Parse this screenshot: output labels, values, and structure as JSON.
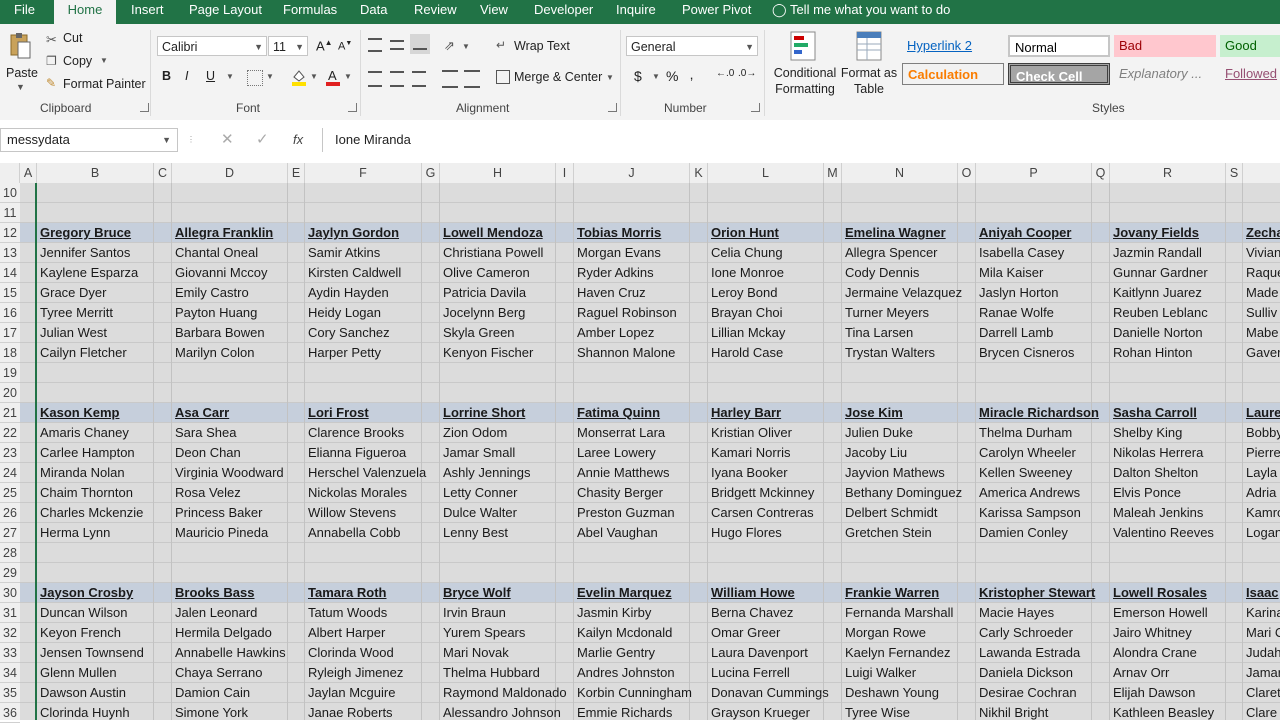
{
  "ribbon_tabs": [
    "File",
    "Home",
    "Insert",
    "Page Layout",
    "Formulas",
    "Data",
    "Review",
    "View",
    "Developer",
    "Inquire",
    "Power Pivot"
  ],
  "tell_me": "Tell me what you want to do",
  "clipboard": {
    "paste": "Paste",
    "cut": "Cut",
    "copy": "Copy",
    "format_painter": "Format Painter",
    "label": "Clipboard"
  },
  "font": {
    "name": "Calibri",
    "size": "11",
    "bold": "B",
    "italic": "I",
    "underline": "U",
    "label": "Font",
    "font_color": "#e02020",
    "fill_color": "#ffe000"
  },
  "alignment": {
    "wrap_text": "Wrap Text",
    "merge_center": "Merge & Center",
    "label": "Alignment"
  },
  "number": {
    "format": "General",
    "currency": "$",
    "percent": "%",
    "comma": "‚",
    "label": "Number"
  },
  "styles": {
    "conditional_formatting": "Conditional Formatting",
    "format_as_table": "Format as Table",
    "label": "Styles",
    "cells": [
      {
        "text": "Hyperlink 2",
        "color": "#0563c1",
        "bg": "#f3f3f3"
      },
      {
        "text": "Normal",
        "color": "#000000",
        "bg": "#ffffff"
      },
      {
        "text": "Bad",
        "color": "#9c0006",
        "bg": "#ffc7ce"
      },
      {
        "text": "Good",
        "color": "#006100",
        "bg": "#c6efce"
      },
      {
        "text": "Calculation",
        "color": "#fa7d00",
        "bg": "#f2f2f2"
      },
      {
        "text": "Check Cell",
        "color": "#ffffff",
        "bg": "#a5a5a5"
      },
      {
        "text": "Explanatory ...",
        "color": "#7f7f7f",
        "bg": "#f3f3f3"
      },
      {
        "text": "Followed",
        "color": "#954f72",
        "bg": "#f3f3f3"
      }
    ]
  },
  "name_box": "messydata",
  "formula": "Ione Miranda",
  "fx": "fx",
  "columns": [
    "A",
    "B",
    "C",
    "D",
    "E",
    "F",
    "G",
    "H",
    "I",
    "J",
    "K",
    "L",
    "M",
    "N",
    "O",
    "P",
    "Q",
    "R",
    "S"
  ],
  "row_numbers": [
    "10",
    "11",
    "12",
    "13",
    "14",
    "15",
    "16",
    "17",
    "18",
    "19",
    "20",
    "21",
    "22",
    "23",
    "24",
    "25",
    "26",
    "27",
    "28",
    "29",
    "30",
    "31",
    "32",
    "33",
    "34",
    "35",
    "36"
  ],
  "header_rows": [
    "12",
    "21",
    "30"
  ],
  "grid": {
    "B": [
      "",
      "",
      "Gregory Bruce",
      "Jennifer Santos",
      "Kaylene Esparza",
      "Grace Dyer",
      "Tyree Merritt",
      "Julian West",
      "Cailyn Fletcher",
      "",
      "",
      "Kason Kemp",
      "Amaris Chaney",
      "Carlee Hampton",
      "Miranda Nolan",
      "Chaim Thornton",
      "Charles Mckenzie",
      "Herma Lynn",
      "",
      "",
      "Jayson Crosby",
      "Duncan Wilson",
      "Keyon French",
      "Jensen Townsend",
      "Glenn Mullen",
      "Dawson Austin",
      "Clorinda Huynh"
    ],
    "D": [
      "",
      "",
      "Allegra Franklin",
      "Chantal Oneal",
      "Giovanni Mccoy",
      "Emily Castro",
      "Payton Huang",
      "Barbara Bowen",
      "Marilyn Colon",
      "",
      "",
      "Asa Carr",
      "Sara Shea",
      "Deon Chan",
      "Virginia Woodward",
      "Rosa Velez",
      "Princess Baker",
      "Mauricio Pineda",
      "",
      "",
      "Brooks Bass",
      "Jalen Leonard",
      "Hermila Delgado",
      "Annabelle Hawkins",
      "Chaya Serrano",
      "Damion Cain",
      "Simone York"
    ],
    "F": [
      "",
      "",
      "Jaylyn Gordon",
      "Samir Atkins",
      "Kirsten Caldwell",
      "Aydin Hayden",
      "Heidy Logan",
      "Cory Sanchez",
      "Harper Petty",
      "",
      "",
      "Lori Frost",
      "Clarence Brooks",
      "Elianna Figueroa",
      "Herschel Valenzuela",
      "Nickolas Morales",
      "Willow Stevens",
      "Annabella Cobb",
      "",
      "",
      "Tamara Roth",
      "Tatum Woods",
      "Albert Harper",
      "Clorinda Wood",
      "Ryleigh Jimenez",
      "Jaylan Mcguire",
      "Janae Roberts"
    ],
    "H": [
      "",
      "",
      "Lowell Mendoza",
      "Christiana Powell",
      "Olive Cameron",
      "Patricia Davila",
      "Jocelynn Berg",
      "Skyla Green",
      "Kenyon Fischer",
      "",
      "",
      "Lorrine Short",
      "Zion Odom",
      "Jamar Small",
      "Ashly Jennings",
      "Letty Conner",
      "Dulce Walter",
      "Lenny Best",
      "",
      "",
      "Bryce Wolf",
      "Irvin Braun",
      "Yurem Spears",
      "Mari Novak",
      "Thelma Hubbard",
      "Raymond Maldonado",
      "Alessandro Johnson"
    ],
    "J": [
      "",
      "",
      "Tobias Morris",
      "Morgan Evans",
      "Ryder Adkins",
      "Haven Cruz",
      "Raguel Robinson",
      "Amber Lopez",
      "Shannon Malone",
      "",
      "",
      "Fatima Quinn",
      "Monserrat Lara",
      "Laree Lowery",
      "Annie Matthews",
      "Chasity Berger",
      "Preston Guzman",
      "Abel Vaughan",
      "",
      "",
      "Evelin Marquez",
      "Jasmin Kirby",
      "Kailyn Mcdonald",
      "Marlie Gentry",
      "Andres Johnston",
      "Korbin Cunningham",
      "Emmie Richards"
    ],
    "L": [
      "",
      "",
      "Orion Hunt",
      "Celia Chung",
      "Ione Monroe",
      "Leroy Bond",
      "Brayan Choi",
      "Lillian Mckay",
      "Harold Case",
      "",
      "",
      "Harley Barr",
      "Kristian Oliver",
      "Kamari Norris",
      "Iyana Booker",
      "Bridgett Mckinney",
      "Carsen Contreras",
      "Hugo Flores",
      "",
      "",
      "William Howe",
      "Berna Chavez",
      "Omar Greer",
      "Laura Davenport",
      "Lucina Ferrell",
      "Donavan Cummings",
      "Grayson Krueger"
    ],
    "N": [
      "",
      "",
      "Emelina Wagner",
      "Allegra Spencer",
      "Cody Dennis",
      "Jermaine Velazquez",
      "Turner Meyers",
      "Tina Larsen",
      "Trystan Walters",
      "",
      "",
      "Jose Kim",
      "Julien Duke",
      "Jacoby Liu",
      "Jayvion Mathews",
      "Bethany Dominguez",
      "Delbert Schmidt",
      "Gretchen Stein",
      "",
      "",
      "Frankie Warren",
      "Fernanda Marshall",
      "Morgan Rowe",
      "Kaelyn Fernandez",
      "Luigi Walker",
      "Deshawn Young",
      "Tyree Wise"
    ],
    "P": [
      "",
      "",
      "Aniyah Cooper",
      "Isabella Casey",
      "Mila Kaiser",
      "Jaslyn Horton",
      "Ranae Wolfe",
      "Darrell Lamb",
      "Brycen Cisneros",
      "",
      "",
      "Miracle Richardson",
      "Thelma Durham",
      "Carolyn Wheeler",
      "Kellen Sweeney",
      "America Andrews",
      "Karissa Sampson",
      "Damien Conley",
      "",
      "",
      "Kristopher Stewart",
      "Macie Hayes",
      "Carly Schroeder",
      "Lawanda Estrada",
      "Daniela Dickson",
      "Desirae Cochran",
      "Nikhil Bright"
    ],
    "R": [
      "",
      "",
      "Jovany Fields",
      "Jazmin Randall",
      "Gunnar Gardner",
      "Kaitlynn Juarez",
      "Reuben Leblanc",
      "Danielle Norton",
      "Rohan Hinton",
      "",
      "",
      "Sasha Carroll",
      "Shelby King",
      "Nikolas Herrera",
      "Dalton Shelton",
      "Elvis Ponce",
      "Maleah Jenkins",
      "Valentino Reeves",
      "",
      "",
      "Lowell Rosales",
      "Emerson Howell",
      "Jairo Whitney",
      "Alondra Crane",
      "Arnav Orr",
      "Elijah Dawson",
      "Kathleen Beasley"
    ],
    "T": [
      "",
      "",
      "Zecha",
      "Vivian",
      "Raque",
      "Made",
      "Sulliv",
      "Mabe",
      "Gaver",
      "",
      "",
      "Laure",
      "Bobby",
      "Pierre",
      "Layla",
      "Adria",
      "Kamro",
      "Logan",
      "",
      "",
      "Isaac",
      "Karina",
      "Mari C",
      "Judah",
      "Jamar",
      "Claret",
      "Clare"
    ]
  }
}
